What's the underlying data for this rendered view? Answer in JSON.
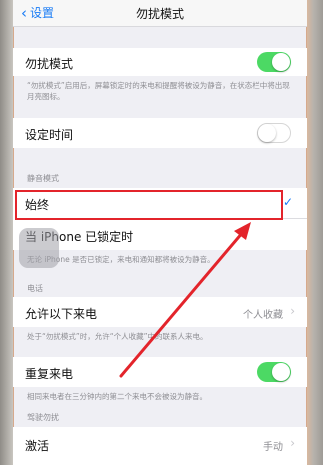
{
  "nav": {
    "back_label": "设置",
    "title": "勿扰模式"
  },
  "dnd": {
    "label": "勿扰模式",
    "toggle_on": true,
    "footnote": "“勿扰模式”启用后，屏幕锁定时的来电和提醒将被设为静音，在状态栏中将出现月亮图标。"
  },
  "scheduled": {
    "label": "设定时间",
    "toggle_on": false
  },
  "silence": {
    "header": "静音模式",
    "always_label": "始终",
    "locked_label": "当 iPhone 已锁定时",
    "footnote": "无论 iPhone 是否已锁定，来电和通知都将被设为静音。"
  },
  "phone": {
    "header": "电话",
    "allow_calls_label": "允许以下来电",
    "allow_calls_value": "个人收藏",
    "footnote": "处于“勿扰模式”时，允许“个人收藏”中的联系人来电。",
    "repeated_label": "重复来电",
    "repeated_on": true,
    "repeated_footnote": "相同来电者在三分钟内的第二个来电不会被设为静音。"
  },
  "driving": {
    "header": "驾驶勿扰",
    "activate_label": "激活",
    "activate_value": "手动"
  },
  "colors": {
    "accent": "#1a7cf5",
    "toggle_on": "#4cd964",
    "annotation": "#e3242b"
  }
}
